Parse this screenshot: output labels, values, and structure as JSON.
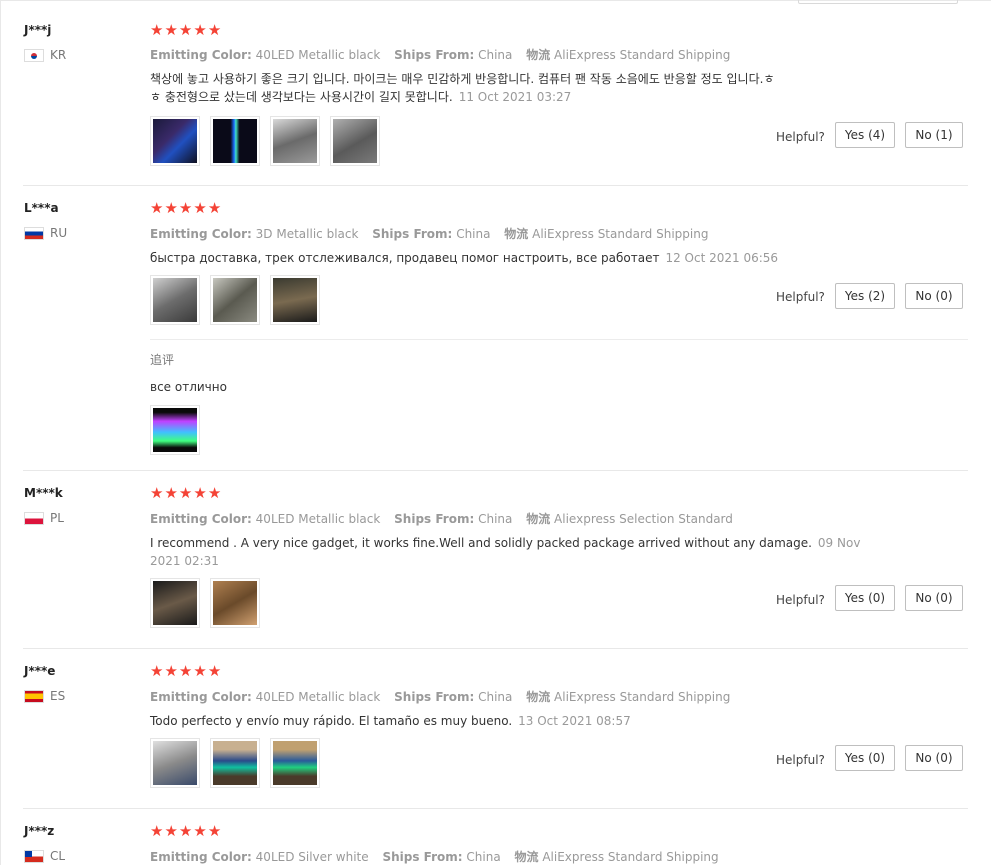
{
  "labels": {
    "emitting_color": "Emitting Color:",
    "ships_from": "Ships From:",
    "logistics": "物流",
    "helpful": "Helpful?"
  },
  "colors": {
    "star": "#f44336",
    "meta": "#999999",
    "divider": "#e8e8e8"
  },
  "reviews": [
    {
      "user": "J***j",
      "country": "KR",
      "flag": "kr-flag",
      "stars": 5,
      "emitting_color": "40LED Metallic black",
      "ships_from": "China",
      "logistics": "AliExpress Standard Shipping",
      "text_lines": [
        "책상에 놓고 사용하기 좋은 크기 입니다. 마이크는 매우 민감하게 반응합니다. 컴퓨터 팬 작동 소음에도 반응할 정도 입니다.ㅎ",
        "ㅎ 충전형으로 샀는데 생각보다는 사용시간이 길지 못합니다."
      ],
      "date": "11 Oct 2021 03:27",
      "thumbs": 4,
      "yes": "Yes (4)",
      "no": "No (1)"
    },
    {
      "user": "L***a",
      "country": "RU",
      "flag": "ru-flag",
      "stars": 5,
      "emitting_color": "3D Metallic black",
      "ships_from": "China",
      "logistics": "AliExpress Standard Shipping",
      "text_lines": [
        "быстра доставка, трек отслеживался, продавец помог настроить, все работает"
      ],
      "date": "12 Oct 2021 06:56",
      "thumbs": 3,
      "yes": "Yes (2)",
      "no": "No (0)",
      "followup": {
        "label": "追评",
        "text": "все отлично",
        "thumbs": 1
      }
    },
    {
      "user": "M***k",
      "country": "PL",
      "flag": "pl-flag",
      "stars": 5,
      "emitting_color": "40LED Metallic black",
      "ships_from": "China",
      "logistics": "Aliexpress Selection Standard",
      "text_lines": [
        "I recommend . A very nice gadget, it works fine.Well and solidly packed package arrived without any damage."
      ],
      "date_line1": "09 Nov",
      "date_line2": "2021 02:31",
      "thumbs": 2,
      "yes": "Yes (0)",
      "no": "No (0)"
    },
    {
      "user": "J***e",
      "country": "ES",
      "flag": "es-flag",
      "stars": 5,
      "emitting_color": "40LED Metallic black",
      "ships_from": "China",
      "logistics": "AliExpress Standard Shipping",
      "text_lines": [
        "Todo perfecto y envío muy rápido. El tamaño es muy bueno."
      ],
      "date": "13 Oct 2021 08:57",
      "thumbs": 3,
      "yes": "Yes (0)",
      "no": "No (0)"
    },
    {
      "user": "J***z",
      "country": "CL",
      "flag": "cl-flag",
      "stars": 5,
      "emitting_color": "40LED Silver white",
      "ships_from": "China",
      "logistics": "AliExpress Standard Shipping"
    }
  ]
}
